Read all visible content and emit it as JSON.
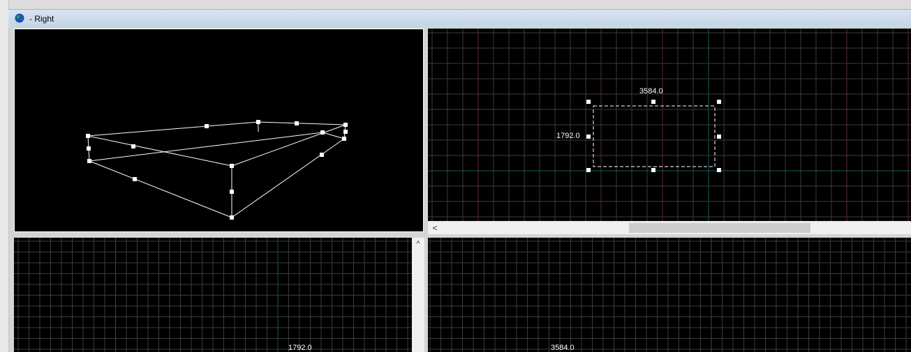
{
  "window": {
    "title": "- Right",
    "icon": "globe-icon"
  },
  "viewports": {
    "perspective": {
      "mode": "3d-wireframe"
    },
    "top": {
      "width_label": "3584.0",
      "height_label": "1792.0"
    },
    "side": {
      "axis_label": "1792.0"
    },
    "front": {
      "axis_label": "3584.0"
    }
  },
  "scrollbars": {
    "left_arrow": "<",
    "up_arrow": "^"
  },
  "colors": {
    "grid_minor": "#3c3c3c",
    "grid_major": "#5a2a2a",
    "grid_axis": "#1e5a5a",
    "handle": "#ffffff"
  }
}
